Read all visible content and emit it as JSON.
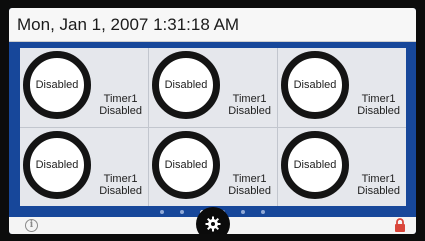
{
  "header": {
    "datetime": "Mon, Jan 1, 2007 1:31:18 AM"
  },
  "timers": [
    {
      "ring_text": "Disabled",
      "name": "Timer1",
      "status": "Disabled"
    },
    {
      "ring_text": "Disabled",
      "name": "Timer1",
      "status": "Disabled"
    },
    {
      "ring_text": "Disabled",
      "name": "Timer1",
      "status": "Disabled"
    },
    {
      "ring_text": "Disabled",
      "name": "Timer1",
      "status": "Disabled"
    },
    {
      "ring_text": "Disabled",
      "name": "Timer1",
      "status": "Disabled"
    },
    {
      "ring_text": "Disabled",
      "name": "Timer1",
      "status": "Disabled"
    }
  ],
  "pager": {
    "page_count": 6,
    "active_page": 3
  },
  "icons": {
    "info": "info-icon",
    "lock": "lock-icon",
    "settings": "gear-icon"
  },
  "colors": {
    "background": "#17479a",
    "panel": "#e5e7ec",
    "lock": "#d9463a"
  }
}
